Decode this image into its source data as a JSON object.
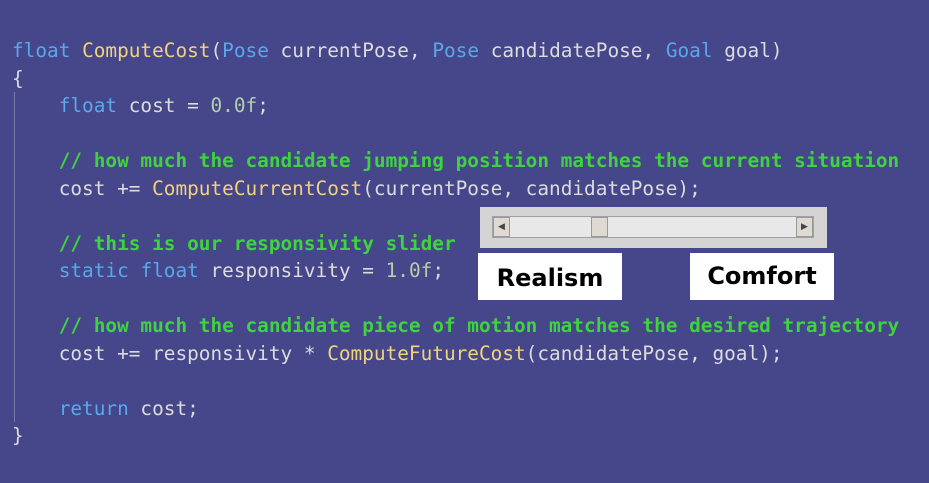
{
  "code_lines": [
    [
      {
        "t": "float",
        "c": "kw"
      },
      {
        "t": " ",
        "c": "tx"
      },
      {
        "t": "ComputeCost",
        "c": "fn"
      },
      {
        "t": "(",
        "c": "tx"
      },
      {
        "t": "Pose",
        "c": "kw"
      },
      {
        "t": " currentPose, ",
        "c": "tx"
      },
      {
        "t": "Pose",
        "c": "kw"
      },
      {
        "t": " candidatePose, ",
        "c": "tx"
      },
      {
        "t": "Goal",
        "c": "kw"
      },
      {
        "t": " goal)",
        "c": "tx"
      }
    ],
    [
      {
        "t": "{",
        "c": "tx"
      }
    ],
    [
      {
        "t": "    ",
        "c": "tx"
      },
      {
        "t": "float",
        "c": "kw"
      },
      {
        "t": " cost = ",
        "c": "tx"
      },
      {
        "t": "0.0f",
        "c": "num"
      },
      {
        "t": ";",
        "c": "tx"
      }
    ],
    [],
    [
      {
        "t": "    // how much the candidate jumping position matches the current situation",
        "c": "cm"
      }
    ],
    [
      {
        "t": "    cost += ",
        "c": "tx"
      },
      {
        "t": "ComputeCurrentCost",
        "c": "fn"
      },
      {
        "t": "(currentPose, candidatePose);",
        "c": "tx"
      }
    ],
    [],
    [
      {
        "t": "    // this is our responsivity slider",
        "c": "cm"
      }
    ],
    [
      {
        "t": "    ",
        "c": "tx"
      },
      {
        "t": "static",
        "c": "kw"
      },
      {
        "t": " ",
        "c": "tx"
      },
      {
        "t": "float",
        "c": "kw"
      },
      {
        "t": " responsivity = ",
        "c": "tx"
      },
      {
        "t": "1.0f",
        "c": "num"
      },
      {
        "t": ";",
        "c": "tx"
      }
    ],
    [],
    [
      {
        "t": "    // how much the candidate piece of motion matches the desired trajectory",
        "c": "cm"
      }
    ],
    [
      {
        "t": "    cost += responsivity * ",
        "c": "tx"
      },
      {
        "t": "ComputeFutureCost",
        "c": "fn"
      },
      {
        "t": "(candidatePose, goal);",
        "c": "tx"
      }
    ],
    [],
    [
      {
        "t": "    ",
        "c": "tx"
      },
      {
        "t": "return",
        "c": "kw"
      },
      {
        "t": " cost;",
        "c": "tx"
      }
    ],
    [
      {
        "t": "}",
        "c": "tx"
      }
    ]
  ],
  "slider": {
    "value_fraction": 0.3,
    "left_arrow_icon": "arrow-left-icon",
    "right_arrow_icon": "arrow-right-icon"
  },
  "labels": {
    "left": "Realism",
    "right": "Comfort"
  },
  "colors": {
    "background": "#46468a",
    "keyword": "#5aa8ec",
    "function": "#f2d27a",
    "comment": "#3fd33f",
    "number": "#b5cea8"
  }
}
